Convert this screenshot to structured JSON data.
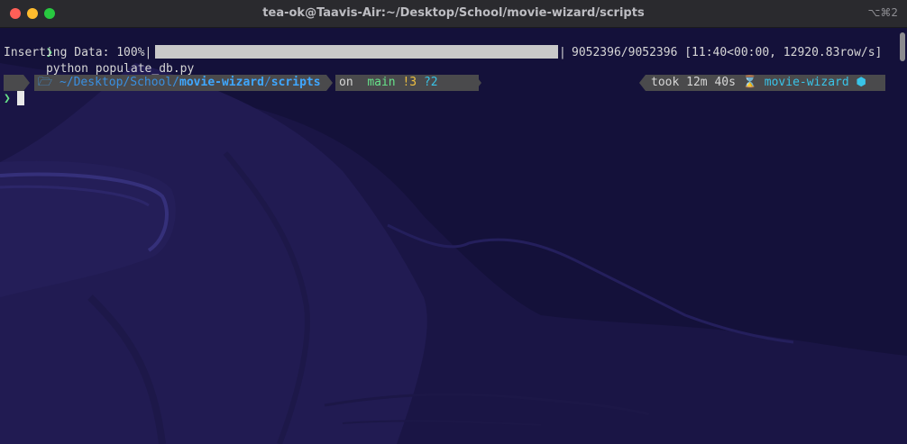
{
  "window": {
    "title": "tea-ok@Taavis-Air:~/Desktop/School/movie-wizard/scripts",
    "shortcut": "⌥⌘2"
  },
  "terminal": {
    "command_prompt": "❯",
    "command": "python populate_db.py",
    "progress_label": "Inserting Data: 100%|",
    "progress_value": 1.0,
    "progress_end": "|",
    "progress_stats": "9052396/9052396 [11:40<00:00, 12920.83row/s]",
    "prompt": {
      "apple_icon": "",
      "folder_icon": "🗁",
      "path_prefix": "~/Desktop/School/",
      "path_bold1": "movie-wizard",
      "path_sep": "/",
      "path_bold2": "scripts",
      "on_text": "on",
      "github_icon": "",
      "branch_icon": "",
      "branch": "main",
      "modified": "!3",
      "untracked": "?2",
      "took_text": "took 12m 40s",
      "hourglass_icon": "⌛",
      "env_name": "movie-wizard",
      "env_icon": "⬢"
    },
    "input_prompt": "❯"
  }
}
